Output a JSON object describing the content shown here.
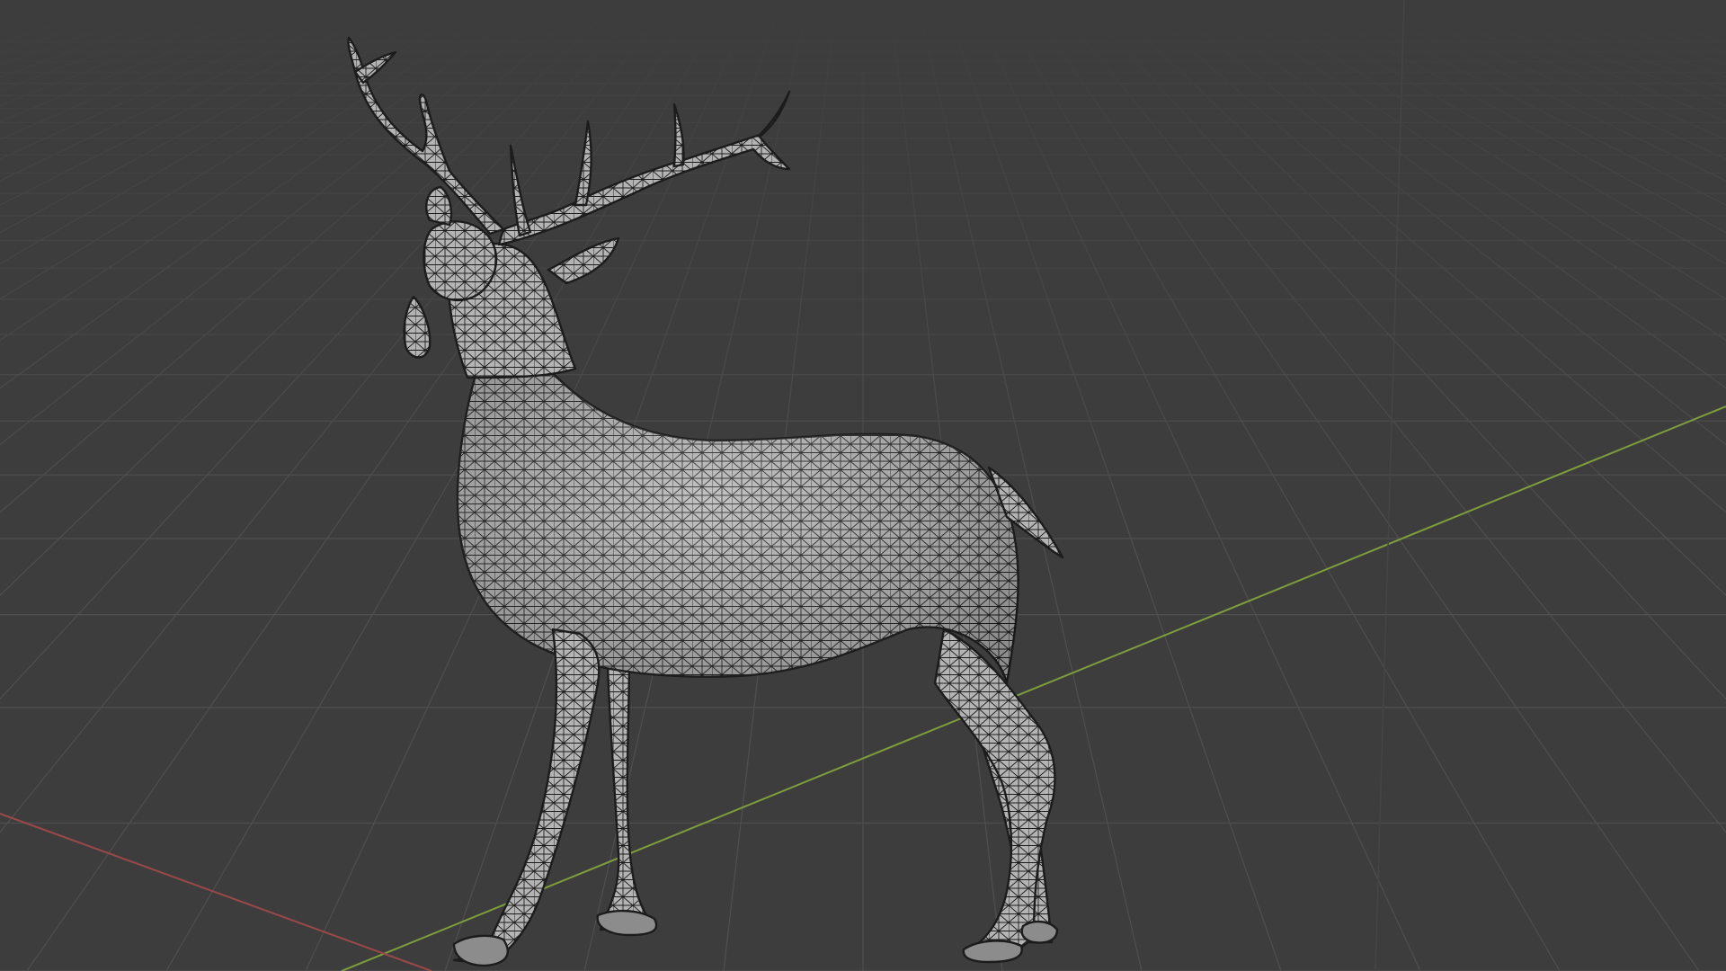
{
  "viewport": {
    "view": "perspective",
    "shading": "solid",
    "overlay": "wireframe",
    "background_color": "#3d3d3d",
    "grid_color": "#4b4b4b",
    "x_axis_color": "#9a4848",
    "y_axis_color": "#7d9e3a"
  },
  "object": {
    "kind": "deer-mesh",
    "surface_color": "#b4b4b4",
    "wire_color": "#1c1c1c"
  }
}
